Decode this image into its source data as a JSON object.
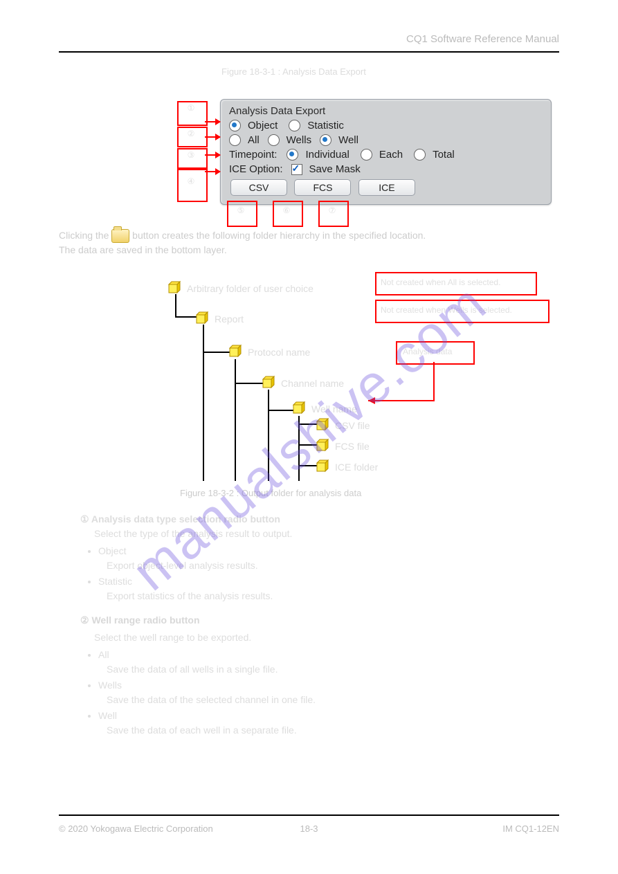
{
  "header": {
    "right": "CQ1 Software Reference Manual"
  },
  "panel": {
    "title": "Analysis Data Export",
    "row1": {
      "opt_object": "Object",
      "opt_statistic": "Statistic"
    },
    "row2": {
      "opt_all": "All",
      "opt_wells": "Wells",
      "opt_well": "Well"
    },
    "row3": {
      "label": "Timepoint:",
      "opt_individual": "Individual",
      "opt_each": "Each",
      "opt_total": "Total"
    },
    "row4": {
      "label": "ICE Option:",
      "opt_savemask": "Save Mask"
    },
    "buttons": {
      "csv": "CSV",
      "fcs": "FCS",
      "ice": "ICE"
    }
  },
  "figcap1": "Figure 18-3-1 : Analysis Data Export",
  "callouts": {
    "c1": "①",
    "c2": "②",
    "c3": "③",
    "c4": "④",
    "c5": "⑤",
    "c6": "⑥",
    "c7": "⑦"
  },
  "desc": {
    "line1_pre": "Clicking the ",
    "line1_post": " button creates the following folder hierarchy in the specified location.",
    "line2": "The data are saved in the bottom layer."
  },
  "tree": {
    "n1": "Arbitrary folder of user choice",
    "n2": "Report",
    "n3": "Protocol name",
    "n4": "Channel name",
    "n5": "Well name",
    "n6": "CSV file",
    "n7": "FCS file",
    "n8": "ICE folder",
    "noteA": "Not created when All is selected.",
    "noteB": "Not created when Wells is selected.",
    "noteC": "Analysis data"
  },
  "figcap2": "Figure 18-3-2 : Output folder for analysis data",
  "section": {
    "no1": "①",
    "no1_title": " Analysis data type selection radio button",
    "no1_body": "Select the type of the analysis result to output.",
    "li_obj_t": "Object",
    "li_obj_b": "Export object-level analysis results.",
    "li_stat_t": "Statistic",
    "li_stat_b": "Export statistics of the analysis results.",
    "no2": "②",
    "no2_title": " Well range radio button",
    "no2_body": "Select the well range to be exported.",
    "li_all_t": "All",
    "li_all_b": "Save the data of all wells in a single file.",
    "li_wells_t": "Wells",
    "li_wells_b": "Save the data of the selected channel in one file.",
    "li_well_t": "Well",
    "li_well_b": "Save the data of each well in a separate file."
  },
  "footer": {
    "left": "© 2020 Yokogawa Electric Corporation",
    "pageno": "18-3",
    "right": "IM CQ1-12EN"
  }
}
